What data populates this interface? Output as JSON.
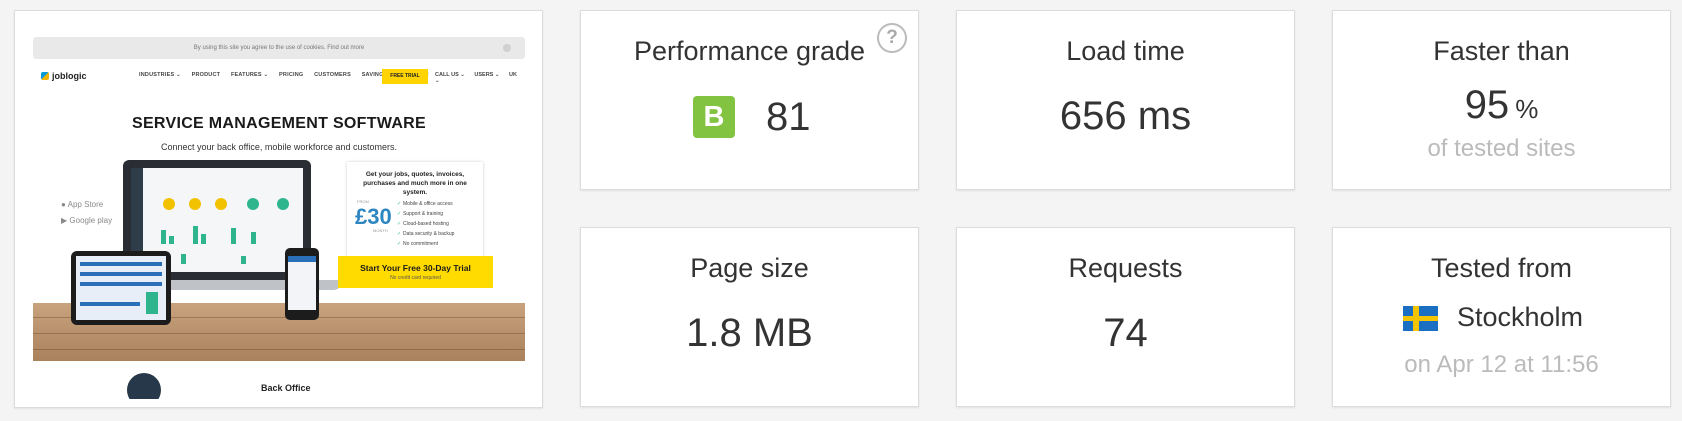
{
  "screenshot": {
    "cookie_text": "By using this site you agree to the use of cookies. Find out more",
    "logo": "joblogic",
    "nav_items": [
      "INDUSTRIES ⌄",
      "PRODUCT",
      "FEATURES ⌄",
      "PRICING",
      "CUSTOMERS",
      "SAVINGS CALCULATOR"
    ],
    "trial_button": "FREE TRIAL",
    "nav_right": [
      "CALL US ⌄",
      "USERS ⌄",
      "UK ⌄"
    ],
    "hero_title": "SERVICE MANAGEMENT SOFTWARE",
    "hero_subtitle": "Connect your back office, mobile workforce and customers.",
    "app_store": "App Store",
    "google_play": "Google play",
    "offer_title": "Get your jobs, quotes, invoices, purchases and much more in one system.",
    "offer_from": "FROM",
    "offer_price": "£30",
    "offer_month": "MONTH",
    "offer_features": [
      "Mobile & office access",
      "Support & training",
      "Cloud-based hosting",
      "Data security & backup",
      "No commitment"
    ],
    "cta_main": "Start Your Free 30-Day Trial",
    "cta_sub": "No credit card required",
    "back_office": "Back Office"
  },
  "performance": {
    "title": "Performance grade",
    "help_icon": "?",
    "grade_letter": "B",
    "grade_color": "#82c341",
    "score": "81"
  },
  "load_time": {
    "title": "Load time",
    "value": "656 ms"
  },
  "faster": {
    "title": "Faster than",
    "value": "95",
    "unit": "%",
    "sub": "of tested sites"
  },
  "page_size": {
    "title": "Page size",
    "value": "1.8 MB"
  },
  "requests": {
    "title": "Requests",
    "value": "74"
  },
  "tested_from": {
    "title": "Tested from",
    "flag_icon": "sweden-flag-icon",
    "city": "Stockholm",
    "date": "on Apr 12 at 11:56"
  }
}
